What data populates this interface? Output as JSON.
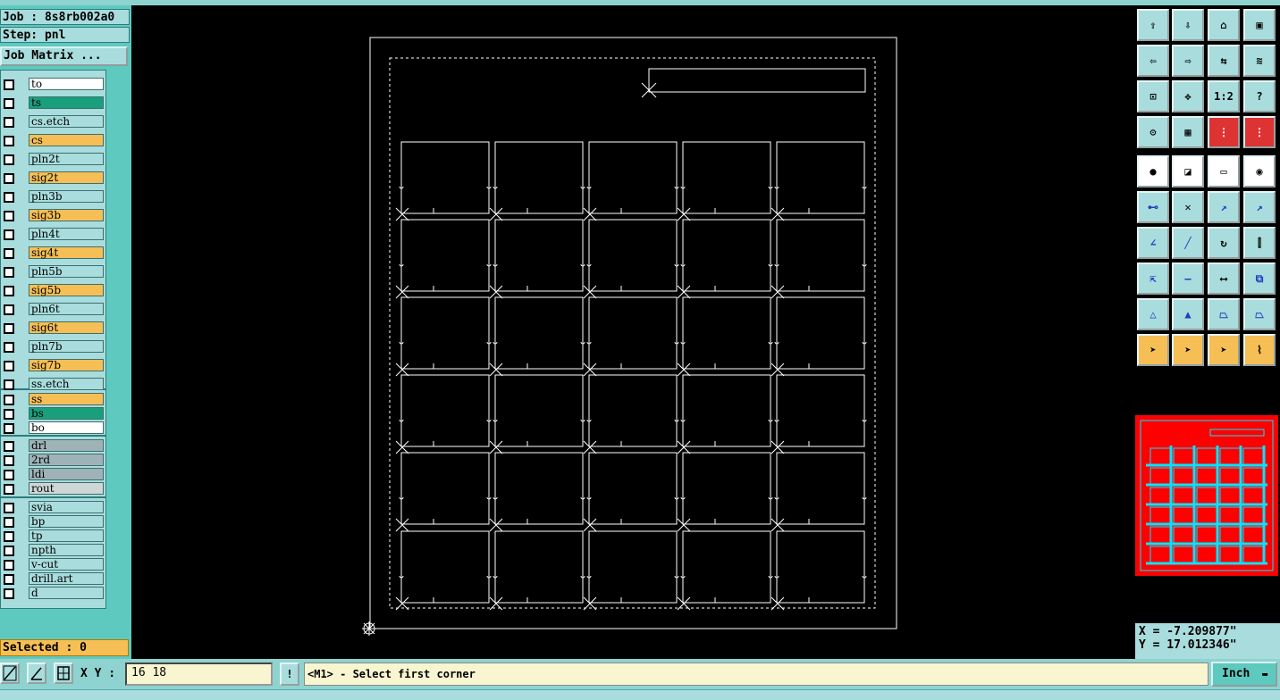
{
  "header": {
    "job": "Job : 8s8rb002a0",
    "step": "Step: pnl",
    "job_matrix_button": "Job Matrix ..."
  },
  "layers": [
    {
      "name": "to",
      "color": "#ffffff"
    },
    {
      "name": "ts",
      "color": "#1a9f7d"
    },
    {
      "name": "cs.etch",
      "color": "#a9dcdc"
    },
    {
      "name": "cs",
      "color": "#f6bf55"
    },
    {
      "name": "pln2t",
      "color": "#a9dcdc"
    },
    {
      "name": "sig2t",
      "color": "#f6bf55"
    },
    {
      "name": "pln3b",
      "color": "#a9dcdc"
    },
    {
      "name": "sig3b",
      "color": "#f6bf55"
    },
    {
      "name": "pln4t",
      "color": "#a9dcdc"
    },
    {
      "name": "sig4t",
      "color": "#f6bf55"
    },
    {
      "name": "pln5b",
      "color": "#a9dcdc"
    },
    {
      "name": "sig5b",
      "color": "#f6bf55"
    },
    {
      "name": "pln6t",
      "color": "#a9dcdc"
    },
    {
      "name": "sig6t",
      "color": "#f6bf55"
    },
    {
      "name": "pln7b",
      "color": "#a9dcdc"
    },
    {
      "name": "sig7b",
      "color": "#f6bf55"
    },
    {
      "name": "ss.etch",
      "color": "#a9dcdc"
    },
    {
      "name": "ss",
      "color": "#f6bf55"
    },
    {
      "name": "bs",
      "color": "#1a9f7d"
    },
    {
      "name": "bo",
      "color": "#ffffff"
    },
    {
      "name": "drl",
      "color": "#9fb3b6"
    },
    {
      "name": "2rd",
      "color": "#9fb3b6"
    },
    {
      "name": "ldi",
      "color": "#9fb3b6"
    },
    {
      "name": "rout",
      "color": "#cfd6d6"
    },
    {
      "name": "svia",
      "color": "#a9dcdc"
    },
    {
      "name": "bp",
      "color": "#a9dcdc"
    },
    {
      "name": "tp",
      "color": "#a9dcdc"
    },
    {
      "name": "npth",
      "color": "#a9dcdc"
    },
    {
      "name": "v-cut",
      "color": "#a9dcdc"
    },
    {
      "name": "drill.art",
      "color": "#a9dcdc"
    },
    {
      "name": "d",
      "color": "#a9dcdc"
    }
  ],
  "selected": "Selected : 0",
  "coords": {
    "x": "X = -7.209877\"",
    "y": "Y = 17.012346\""
  },
  "bottom": {
    "xy_label": "X Y :",
    "xy_value": "16 18",
    "bang_button": "!",
    "status_message": "<M1> - Select first corner",
    "units": "Inch"
  },
  "tools": [
    {
      "name": "layer-up-icon",
      "glyph": "⇧",
      "style": "cyan"
    },
    {
      "name": "layer-down-icon",
      "glyph": "⇩",
      "style": "cyan"
    },
    {
      "name": "home-icon",
      "glyph": "⌂",
      "style": "cyan"
    },
    {
      "name": "window-icon",
      "glyph": "▣",
      "style": "cyan"
    },
    {
      "name": "left-icon",
      "glyph": "⇦",
      "style": "cyan"
    },
    {
      "name": "right-icon",
      "glyph": "⇨",
      "style": "cyan"
    },
    {
      "name": "swap-icon",
      "glyph": "⇆",
      "style": "cyan"
    },
    {
      "name": "redraw-icon",
      "glyph": "≋",
      "style": "cyan"
    },
    {
      "name": "zoom-fit-icon",
      "glyph": "⊡",
      "style": "cyan"
    },
    {
      "name": "pan-icon",
      "glyph": "✥",
      "style": "cyan"
    },
    {
      "name": "scale-icon",
      "glyph": "1:2",
      "style": "cyan"
    },
    {
      "name": "help-icon",
      "glyph": "?",
      "style": "cyan"
    },
    {
      "name": "tool-icon",
      "glyph": "⚙",
      "style": "cyan"
    },
    {
      "name": "grid-icon",
      "glyph": "▦",
      "style": "cyan"
    },
    {
      "name": "net-icon",
      "glyph": "⋮",
      "style": "cyan"
    },
    {
      "name": "net-compare-icon",
      "glyph": "⋮",
      "style": "cyan"
    },
    {
      "name": "fill-icon",
      "glyph": "●",
      "style": "white"
    },
    {
      "name": "outline-icon",
      "glyph": "◪",
      "style": "white"
    },
    {
      "name": "ruler-icon",
      "glyph": "▭",
      "style": "white"
    },
    {
      "name": "pad-icon",
      "glyph": "◉",
      "style": "white"
    },
    {
      "name": "connect-icon",
      "glyph": "⊷",
      "style": "cyan"
    },
    {
      "name": "cross-icon",
      "glyph": "✕",
      "style": "cyan"
    },
    {
      "name": "snap-icon",
      "glyph": "↗",
      "style": "cyan"
    },
    {
      "name": "snap-center-icon",
      "glyph": "↗",
      "style": "cyan"
    },
    {
      "name": "angle-icon",
      "glyph": "∠",
      "style": "cyan"
    },
    {
      "name": "line-icon",
      "glyph": "╱",
      "style": "cyan"
    },
    {
      "name": "rotate-icon",
      "glyph": "↻",
      "style": "cyan"
    },
    {
      "name": "mirror-icon",
      "glyph": "⫿",
      "style": "cyan"
    },
    {
      "name": "move-icon",
      "glyph": "⇱",
      "style": "cyan"
    },
    {
      "name": "dash-icon",
      "glyph": "—",
      "style": "cyan"
    },
    {
      "name": "measure-icon",
      "glyph": "⟷",
      "style": "cyan"
    },
    {
      "name": "copy-icon",
      "glyph": "⧉",
      "style": "cyan"
    },
    {
      "name": "triangle-small-icon",
      "glyph": "△",
      "style": "cyan"
    },
    {
      "name": "triangle-icon",
      "glyph": "▲",
      "style": "cyan"
    },
    {
      "name": "trapezoid-icon",
      "glyph": "⏢",
      "style": "cyan"
    },
    {
      "name": "trapezoid-line-icon",
      "glyph": "⏢",
      "style": "cyan"
    },
    {
      "name": "pointer-icon",
      "glyph": "➤",
      "style": "orange"
    },
    {
      "name": "pointer-select-icon",
      "glyph": "➤",
      "style": "orange"
    },
    {
      "name": "pointer-edit-icon",
      "glyph": "➤",
      "style": "orange"
    },
    {
      "name": "route-icon",
      "glyph": "⌇",
      "style": "orange"
    }
  ],
  "colors": {
    "canvas": "#000000",
    "panel_cyan": "#a9dcdc",
    "panel_teal": "#5ec9bf",
    "orange": "#f6bf55",
    "green": "#1a9f7d",
    "minimap_red": "#ff0000",
    "minimap_grid": "#00e5ff",
    "drawing_white": "#ffffff"
  }
}
